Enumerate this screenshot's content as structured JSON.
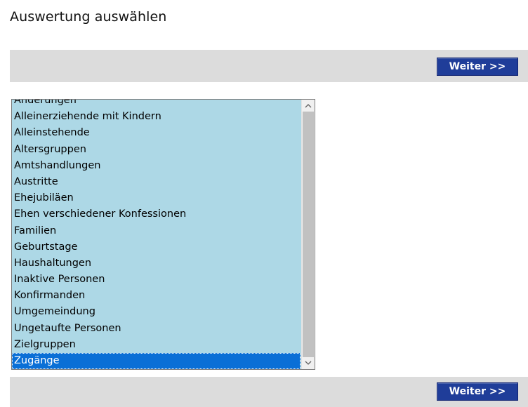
{
  "page": {
    "title": "Auswertung auswählen"
  },
  "toolbar_top": {
    "button_label": "Weiter >>"
  },
  "toolbar_bottom": {
    "button_label": "Weiter >>"
  },
  "listbox": {
    "items": [
      "Änderungen",
      "Alleinerziehende mit Kindern",
      "Alleinstehende",
      "Altersgruppen",
      "Amtshandlungen",
      "Austritte",
      "Ehejubiläen",
      "Ehen verschiedener Konfessionen",
      "Familien",
      "Geburtstage",
      "Haushaltungen",
      "Inaktive Personen",
      "Konfirmanden",
      "Umgemeindung",
      "Ungetaufte Personen",
      "Zielgruppen",
      "Zugänge"
    ],
    "selected": "Zugänge",
    "scroll_position": 1.0
  },
  "colors": {
    "list_background": "#add8e6",
    "selection": "#0a6fd6",
    "button": "#1f3d99",
    "toolbar": "#dcdcdc"
  },
  "icons": {
    "scroll_up": "chevron-up-icon",
    "scroll_down": "chevron-down-icon"
  }
}
